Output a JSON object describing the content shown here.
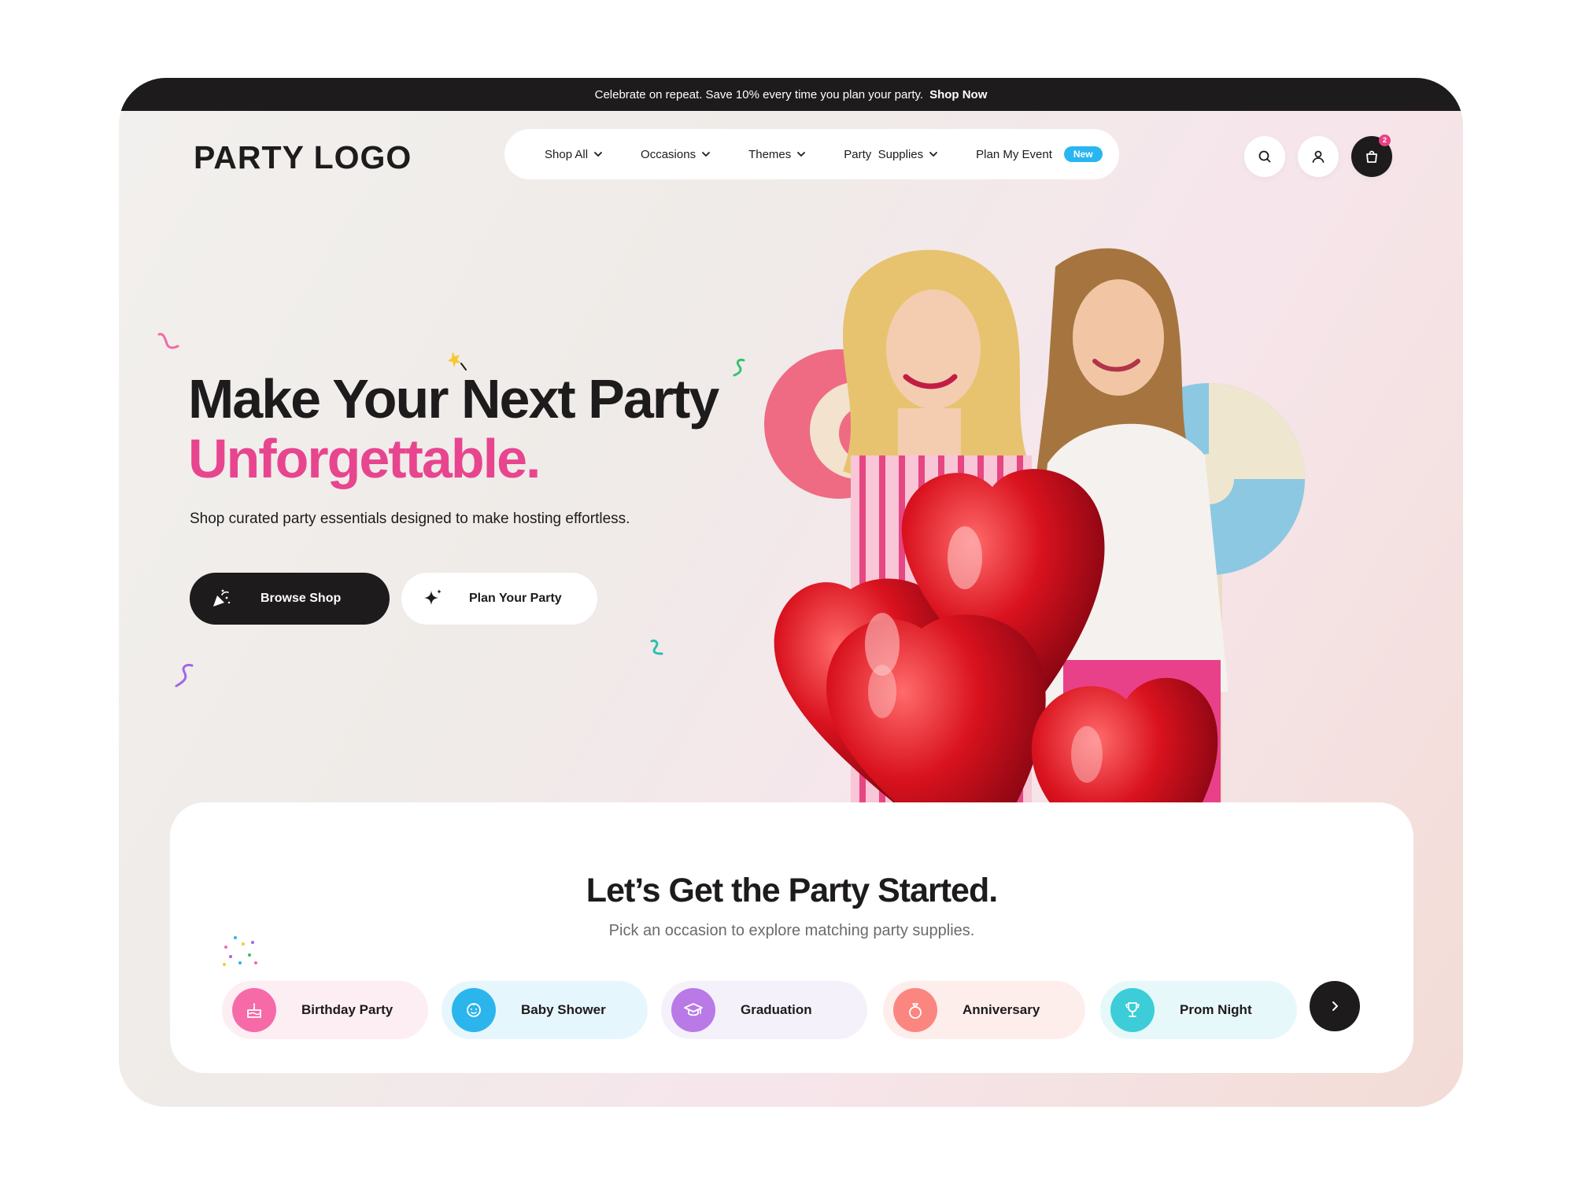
{
  "announcement": {
    "text": "Celebrate on repeat. Save 10% every time you plan your party.",
    "cta": "Shop Now"
  },
  "brand": {
    "logo": "PARTY LOGO"
  },
  "nav": {
    "items": [
      {
        "label": "Shop All"
      },
      {
        "label": "Occasions"
      },
      {
        "label": "Themes"
      },
      {
        "label": "Party  Supplies"
      },
      {
        "label": "Plan My Event",
        "badge": "New"
      }
    ]
  },
  "header_icons": {
    "search": "search-icon",
    "account": "user-icon",
    "cart": "shopping-bag-icon",
    "cart_count": "2"
  },
  "hero": {
    "title": "Make Your Next Party",
    "title_accent": "Unforgettable.",
    "subtitle": "Shop curated party essentials designed to make hosting effortless.",
    "primary_button": "Browse Shop",
    "secondary_button": "Plan Your Party",
    "image_alt": "Two women holding red heart balloons and giant lollipops"
  },
  "occasions": {
    "title": "Let’s Get the Party Started.",
    "subtitle": "Pick an occasion to explore matching party supplies.",
    "items": [
      {
        "label": "Birthday Party",
        "icon": "cake-icon",
        "color": "#f76aa8",
        "bg": "#fdeef4"
      },
      {
        "label": "Baby Shower",
        "icon": "baby-icon",
        "color": "#2bb5ec",
        "bg": "#e6f6fd"
      },
      {
        "label": "Graduation",
        "icon": "graduation-cap-icon",
        "color": "#b979e6",
        "bg": "#f4f1fa"
      },
      {
        "label": "Anniversary",
        "icon": "ring-icon",
        "color": "#fb8680",
        "bg": "#fdeeec"
      },
      {
        "label": "Prom Night",
        "icon": "trophy-icon",
        "color": "#3ccdd8",
        "bg": "#e7f8fa"
      }
    ],
    "next_icon": "chevron-right-icon"
  },
  "colors": {
    "accent": "#e8458f",
    "dark": "#1d1b1c",
    "badge": "#29b6f0"
  }
}
